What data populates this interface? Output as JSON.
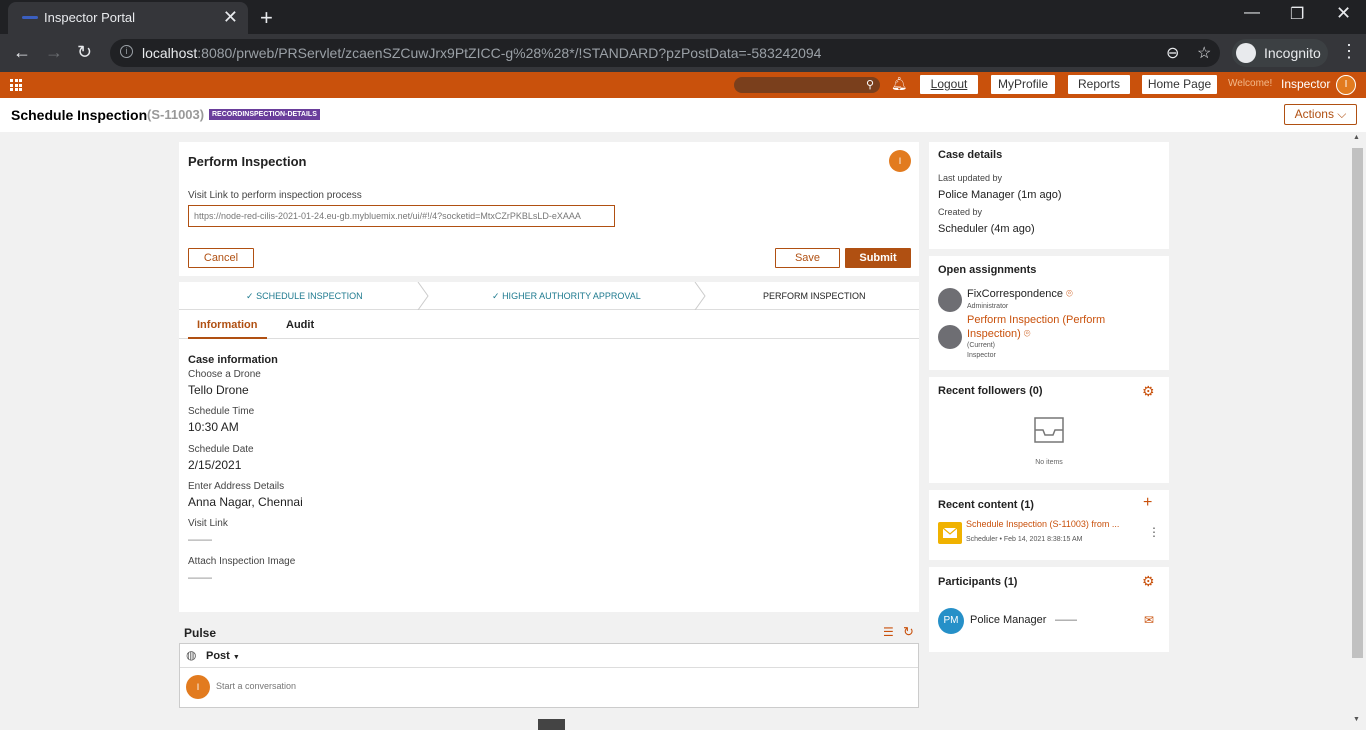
{
  "browser": {
    "tab_title": "Inspector Portal",
    "url_host": "localhost",
    "url_rest": ":8080/prweb/PRServlet/zcaenSZCuwJrx9PtZICC-g%28%28*/!STANDARD?pzPostData=-583242094",
    "incognito_label": "Incognito"
  },
  "header": {
    "buttons": [
      "Logout",
      "MyProfile",
      "Reports",
      "Home Page"
    ],
    "welcome": "Welcome!",
    "user": "Inspector",
    "avatar": "I"
  },
  "case": {
    "title": "Schedule Inspection",
    "id": "(S-11003)",
    "badge": "RECORDINSPECTION-DETAILS",
    "actions": "Actions"
  },
  "assignment": {
    "title": "Perform Inspection",
    "avatar": "I",
    "visit_label": "Visit Link to perform inspection process",
    "visit_value": "https://node-red-cilis-2021-01-24.eu-gb.mybluemix.net/ui/#!/4?socketid=MtxCZrPKBLsLD-eXAAA",
    "cancel": "Cancel",
    "save": "Save",
    "submit": "Submit"
  },
  "stages": [
    {
      "label": "SCHEDULE INSPECTION",
      "done": true
    },
    {
      "label": "HIGHER AUTHORITY APPROVAL",
      "done": true
    },
    {
      "label": "PERFORM INSPECTION",
      "done": false
    }
  ],
  "tabs": [
    "Information",
    "Audit"
  ],
  "info": {
    "section": "Case information",
    "fields": [
      {
        "label": "Choose a Drone",
        "value": "Tello Drone"
      },
      {
        "label": "Schedule Time",
        "value": "10:30 AM"
      },
      {
        "label": "Schedule Date",
        "value": "2/15/2021"
      },
      {
        "label": "Enter Address Details",
        "value": "Anna Nagar, Chennai"
      },
      {
        "label": "Visit Link",
        "value": "——"
      },
      {
        "label": "Attach Inspection Image",
        "value": "——"
      }
    ]
  },
  "pulse": {
    "title": "Pulse",
    "post": "Post",
    "placeholder": "Start a conversation",
    "avatar": "I"
  },
  "sidebar": {
    "case_details": {
      "title": "Case details",
      "updated_label": "Last updated by",
      "updated_value": "Police Manager (1m ago)",
      "created_label": "Created by",
      "created_value": "Scheduler (4m ago)"
    },
    "open_assignments": {
      "title": "Open assignments",
      "items": [
        {
          "name": "FixCorrespondence",
          "sub": "Administrator"
        },
        {
          "name": "Perform Inspection (Perform Inspection)",
          "sub": "(Current)",
          "sub2": "Inspector"
        }
      ]
    },
    "followers": {
      "title": "Recent followers",
      "count": "(0)",
      "empty": "No items"
    },
    "recent_content": {
      "title": "Recent content",
      "count": "(1)",
      "item_title": "Schedule Inspection (S-11003) from ...",
      "item_author": "Scheduler",
      "item_date": "Feb 14, 2021 8:38:15 AM"
    },
    "participants": {
      "title": "Participants",
      "count": "(1)",
      "items": [
        {
          "initials": "PM",
          "name": "Police Manager",
          "extra": "——"
        }
      ]
    }
  },
  "colors": {
    "accent": "#c9510c",
    "stage_done": "#1e7a8f",
    "badge": "#6a3e9b"
  }
}
